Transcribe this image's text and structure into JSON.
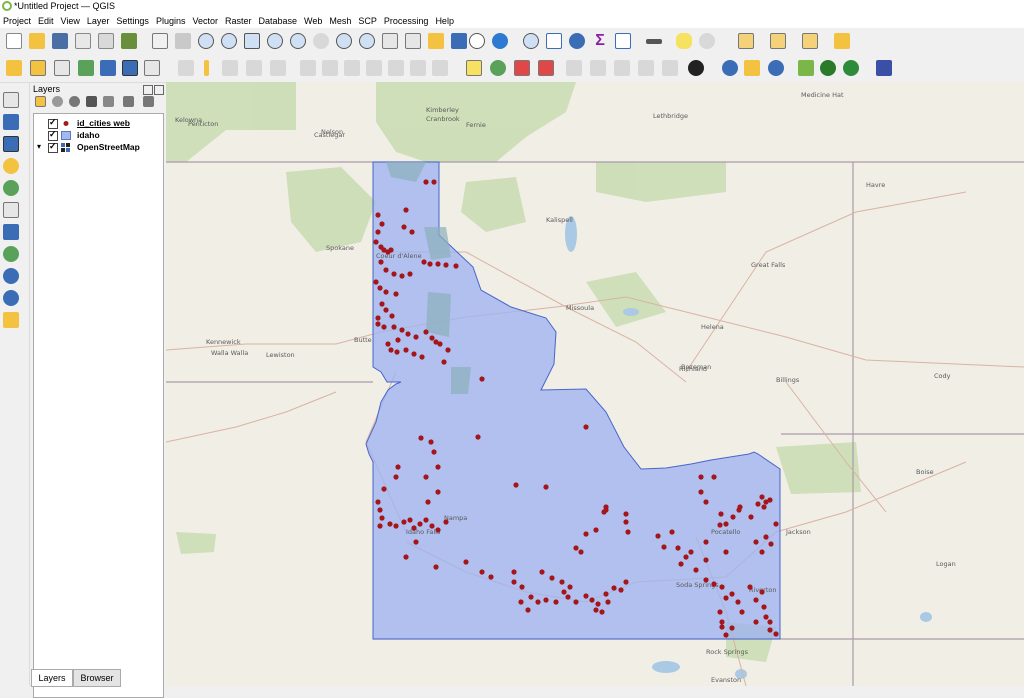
{
  "window": {
    "title": "*Untitled Project — QGIS"
  },
  "menu": [
    "Project",
    "Edit",
    "View",
    "Layer",
    "Settings",
    "Plugins",
    "Vector",
    "Raster",
    "Database",
    "Web",
    "Mesh",
    "SCP",
    "Processing",
    "Help"
  ],
  "layers_panel": {
    "title": "Layers",
    "layers": [
      {
        "name": "id_cities web",
        "checked": true,
        "symbol": "point",
        "color": "#a01c20"
      },
      {
        "name": "idaho",
        "checked": true,
        "symbol": "polygon",
        "color": "#a3b8ee"
      },
      {
        "name": "OpenStreetMap",
        "checked": true,
        "symbol": "raster"
      }
    ]
  },
  "tabs": {
    "layers": "Layers",
    "browser": "Browser"
  },
  "map": {
    "polygon_fill": "#9fb3ef",
    "point_color": "#a4161b",
    "place_labels": [
      "Kelowna",
      "Penticton",
      "Nelson",
      "Kimberley",
      "Cranbrook",
      "Fernie",
      "Lethbridge",
      "Medicine Hat",
      "Castlegar",
      "Kalispell",
      "Havre",
      "Spokane",
      "Coeur d'Alene",
      "Great Falls",
      "Missoula",
      "Helena",
      "Richland",
      "Kennewick",
      "Walla Walla",
      "Lewiston",
      "Butte",
      "Bozeman",
      "Billings",
      "Cody",
      "Boise",
      "Nampa",
      "Idaho Falls",
      "Pocatello",
      "Jackson",
      "Soda Springs",
      "Riverton",
      "Logan",
      "Rock Springs",
      "Evanston"
    ]
  }
}
